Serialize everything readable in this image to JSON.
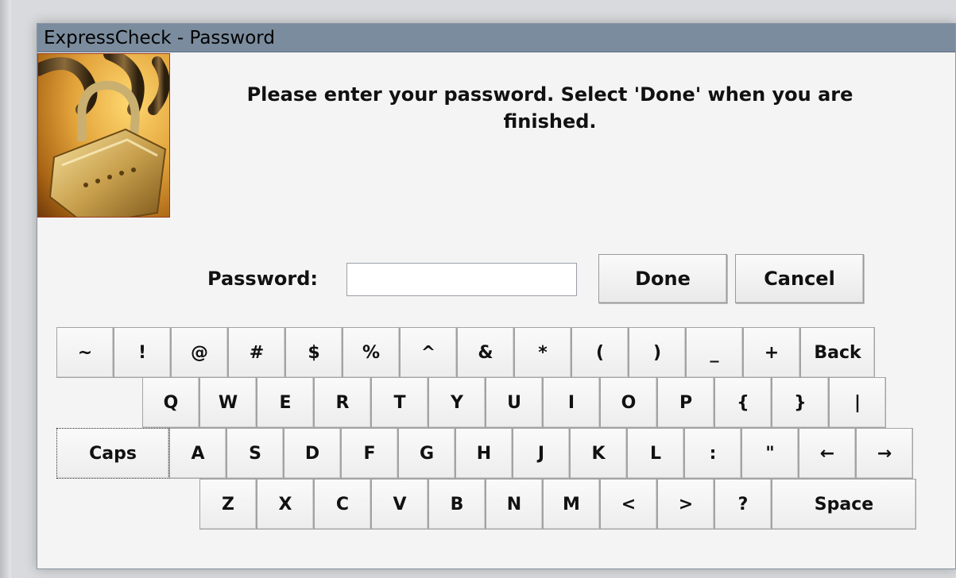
{
  "window": {
    "title": "ExpressCheck - Password"
  },
  "message": "Please enter your password.  Select 'Done' when you are finished.",
  "password": {
    "label": "Password:",
    "value": "",
    "placeholder": ""
  },
  "buttons": {
    "done": "Done",
    "cancel": "Cancel"
  },
  "keyboard": {
    "row1": [
      "~",
      "!",
      "@",
      "#",
      "$",
      "%",
      "^",
      "&",
      "*",
      "(",
      ")",
      "_",
      "+",
      "Back"
    ],
    "row2": [
      "Q",
      "W",
      "E",
      "R",
      "T",
      "Y",
      "U",
      "I",
      "O",
      "P",
      "{",
      "}",
      "|"
    ],
    "row3": [
      "Caps",
      "A",
      "S",
      "D",
      "F",
      "G",
      "H",
      "J",
      "K",
      "L",
      ":",
      "\"",
      "←",
      "→"
    ],
    "row4": [
      "Z",
      "X",
      "C",
      "V",
      "B",
      "N",
      "M",
      "<",
      ">",
      "?",
      "Space"
    ]
  },
  "colors": {
    "titlebar": "#7b8c9e",
    "window_bg": "#f4f4f4"
  },
  "icons": {
    "lock_image": "padlock-chain-photo"
  }
}
